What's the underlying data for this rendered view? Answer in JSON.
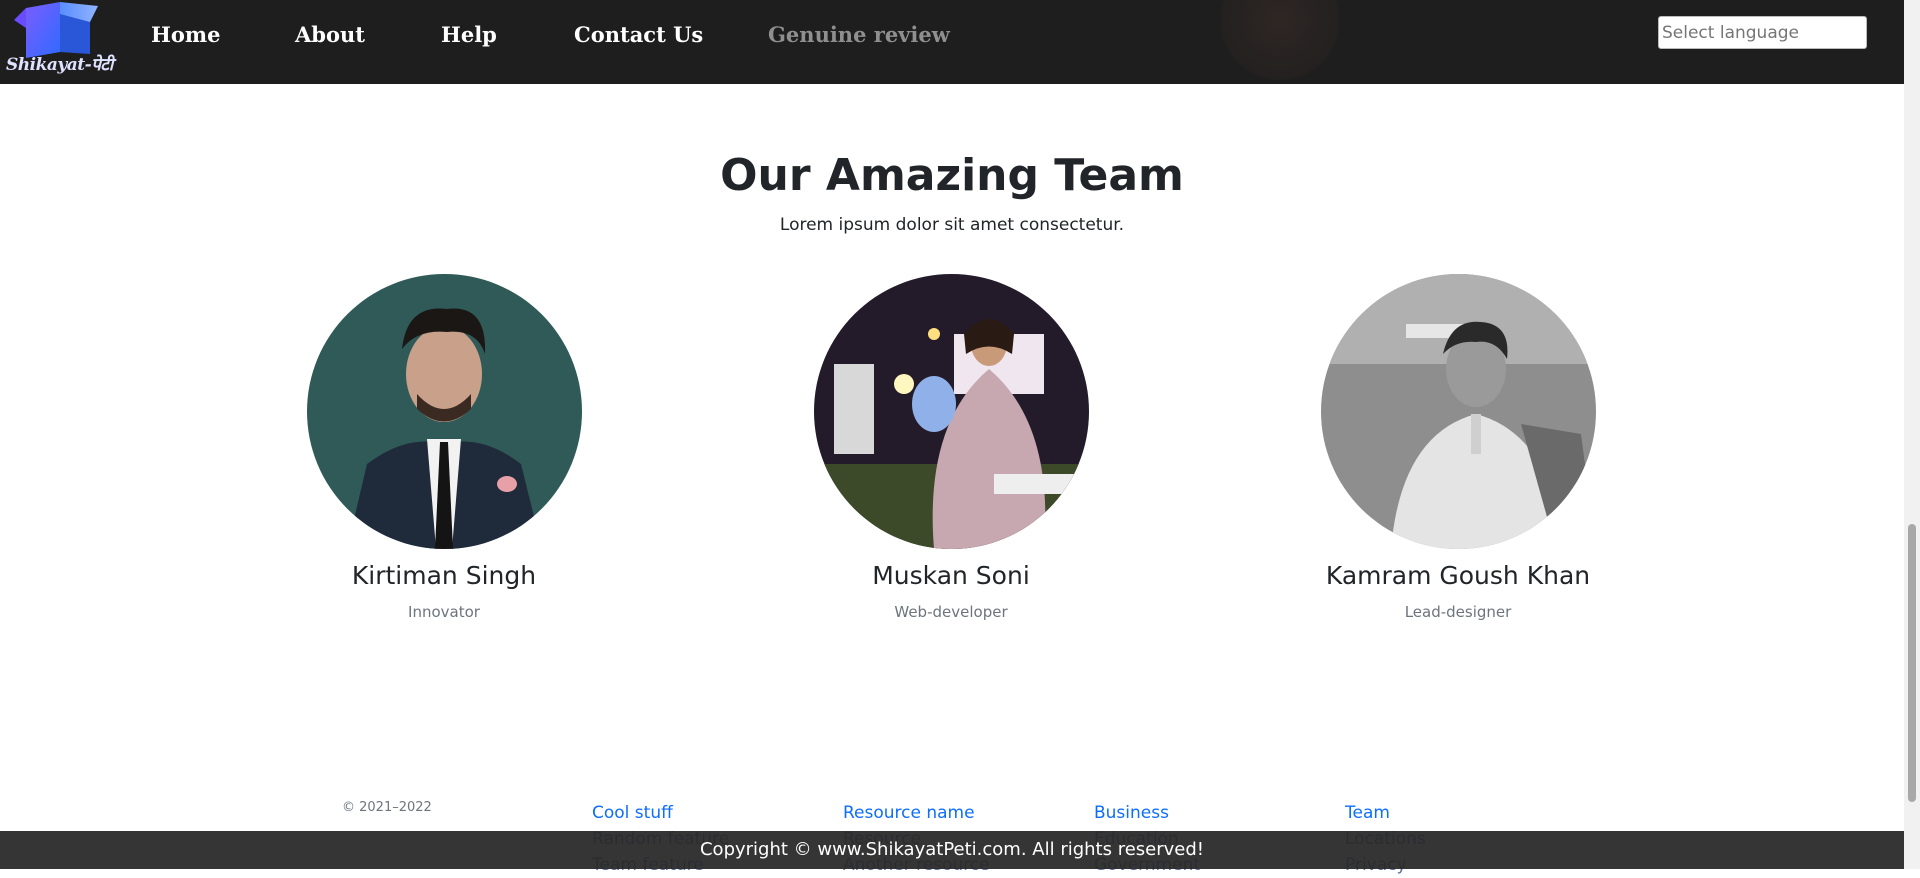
{
  "navbar": {
    "logo_text": "Shikayat-पेटी",
    "links": [
      "Home",
      "About",
      "Help",
      "Contact Us",
      "Genuine review"
    ],
    "language_placeholder": "Select language"
  },
  "team": {
    "title": "Our Amazing Team",
    "subtitle": "Lorem ipsum dolor sit amet consectetur.",
    "members": [
      {
        "name": "Kirtiman Singh",
        "role": "Innovator"
      },
      {
        "name": "Muskan Soni",
        "role": "Web-developer"
      },
      {
        "name": "Kamram Goush Khan",
        "role": "Lead-designer"
      }
    ]
  },
  "footer": {
    "year_range": "© 2021–2022",
    "columns": [
      [
        "Cool stuff",
        "Random feature",
        "Team feature"
      ],
      [
        "Resource name",
        "Resource",
        "Another resource"
      ],
      [
        "Business",
        "Education",
        "Government"
      ],
      [
        "Team",
        "Locations",
        "Privacy"
      ]
    ],
    "copyright": "Copyright © www.ShikayatPeti.com. All rights reserved!"
  },
  "colors": {
    "navbar_bg": "#1e1e1e",
    "link": "#0d6efd",
    "muted_nav": "#8f8f8f",
    "copyright_bar": "#282828"
  }
}
